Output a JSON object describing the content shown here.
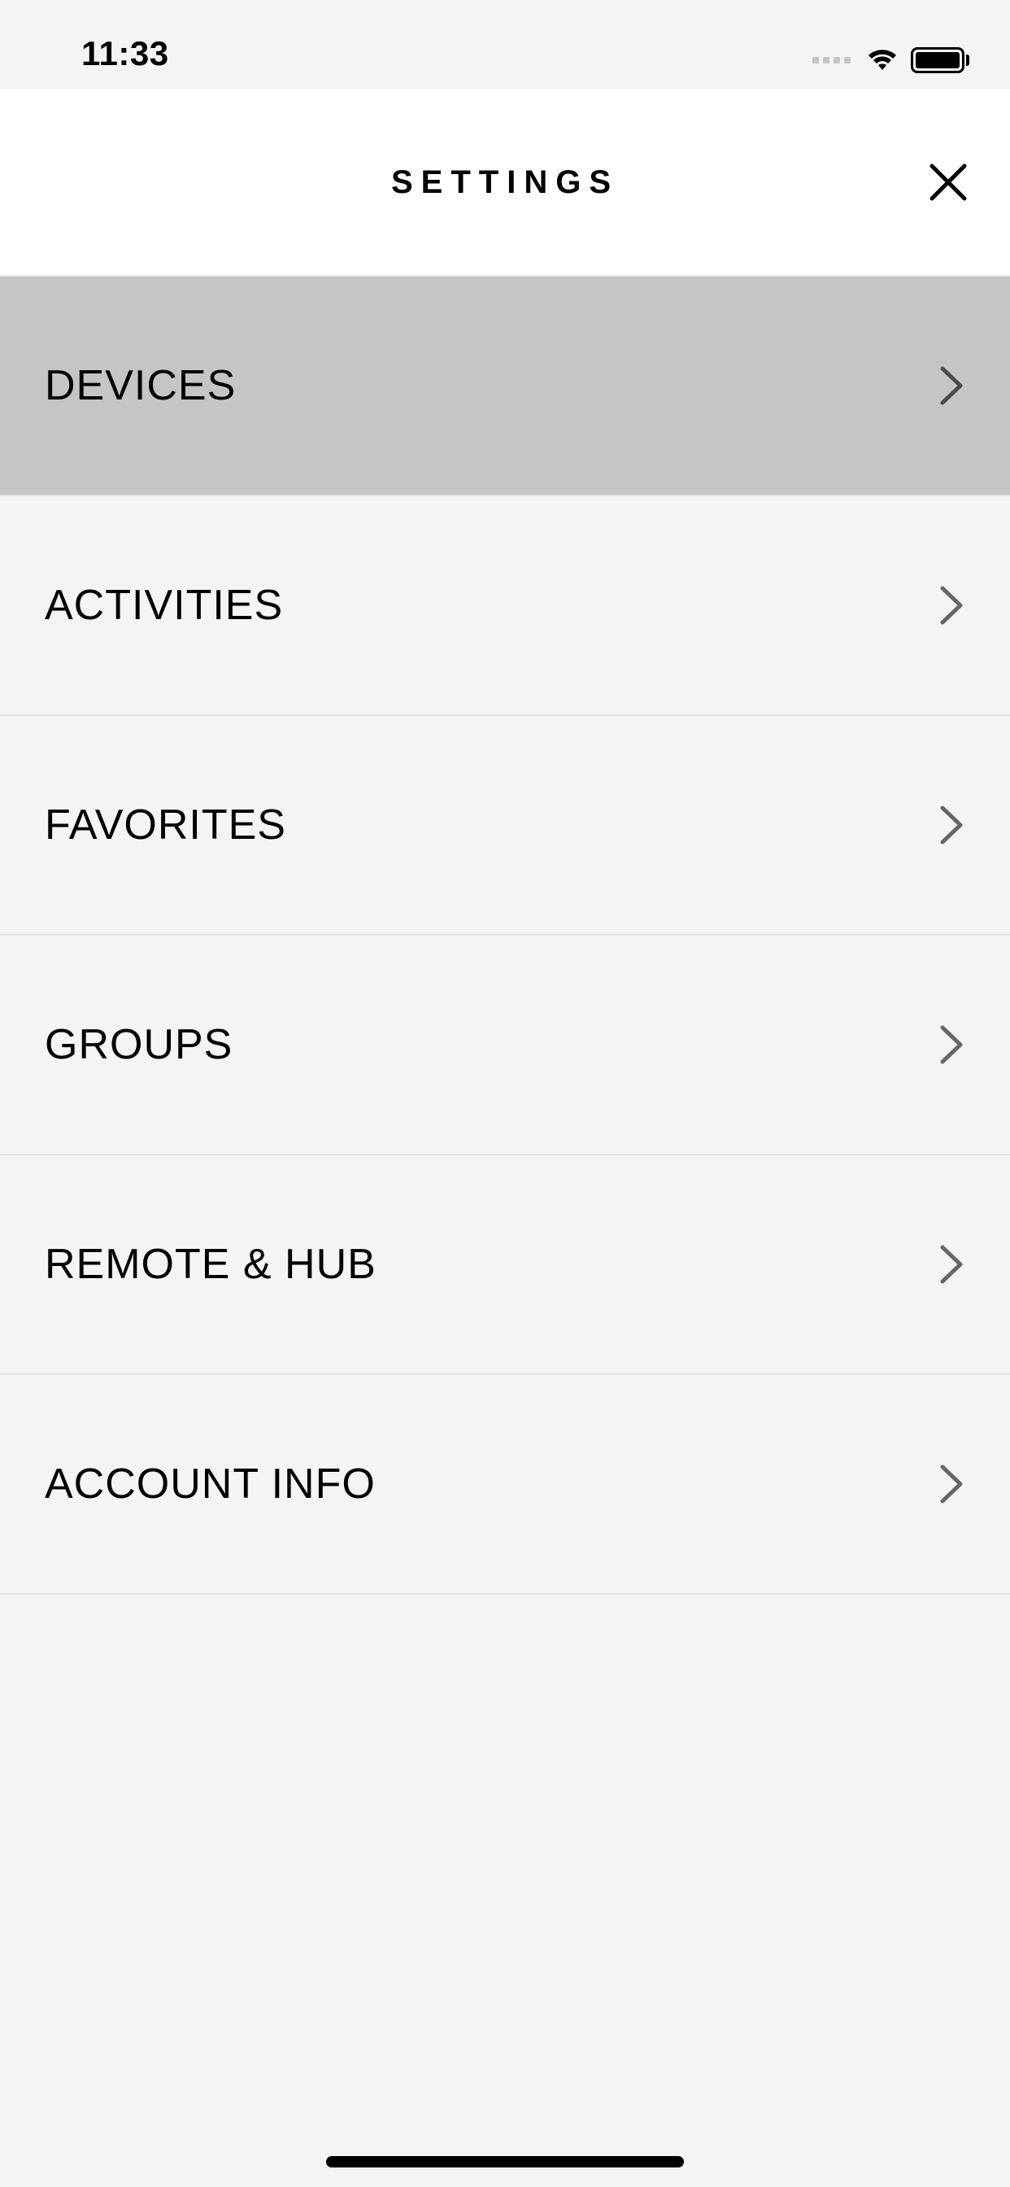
{
  "status": {
    "time": "11:33"
  },
  "header": {
    "title": "SETTINGS"
  },
  "menu": {
    "items": [
      {
        "label": "DEVICES",
        "selected": true
      },
      {
        "label": "ACTIVITIES",
        "selected": false
      },
      {
        "label": "FAVORITES",
        "selected": false
      },
      {
        "label": "GROUPS",
        "selected": false
      },
      {
        "label": "REMOTE & HUB",
        "selected": false
      },
      {
        "label": "ACCOUNT INFO",
        "selected": false
      }
    ]
  }
}
